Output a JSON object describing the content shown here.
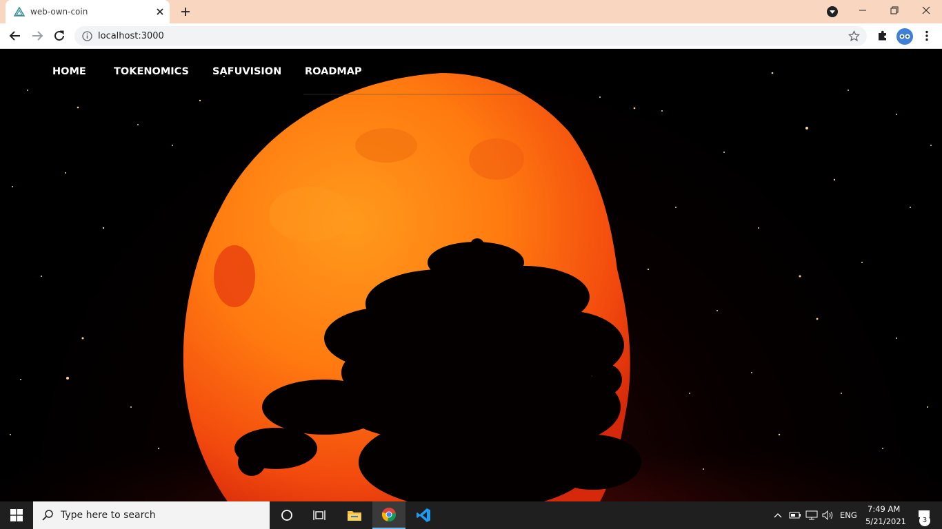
{
  "browser": {
    "tab": {
      "title": "web-own-coin",
      "favicon": "nuxt-triangle-icon"
    },
    "new_tab_icon": "plus-icon",
    "address": {
      "url": "localhost:3000",
      "info_icon": "info-icon"
    },
    "toolbar_icons": [
      "back-arrow-icon",
      "forward-arrow-icon",
      "reload-icon",
      "star-icon",
      "extensions-puzzle-icon",
      "profile-avatar",
      "more-vert-icon"
    ],
    "window_controls": [
      "minimize-icon",
      "restore-icon",
      "close-icon"
    ]
  },
  "page": {
    "nav": {
      "home": "HOME",
      "tokenomics": "TOKENOMICS",
      "safuvision": "SAFUVISION",
      "roadmap": "ROADMAP"
    },
    "hero_image": "blood-moon-with-tree-silhouette",
    "colors": {
      "moon_light": "#ff8a12",
      "moon_dark": "#e83a10",
      "sky": "#000000",
      "nav_text": "#ffffff"
    }
  },
  "taskbar": {
    "search_placeholder": "Type here to search",
    "tray": {
      "language": "ENG",
      "time": "7:49 AM",
      "date": "5/21/2021",
      "notifications": "3"
    },
    "pinned": [
      "cortana-icon",
      "task-view-icon",
      "file-explorer-icon",
      "chrome-icon",
      "vscode-icon"
    ]
  }
}
